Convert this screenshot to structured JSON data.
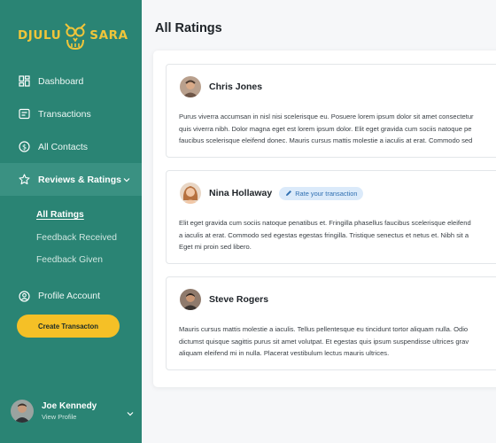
{
  "brand": {
    "left": "DJULU",
    "right": "SARA",
    "accent": "#f0c53a",
    "sidebar_bg": "#2a8474"
  },
  "nav": {
    "dashboard": "Dashboard",
    "transactions": "Transactions",
    "contacts": "All Contacts",
    "reviews": "Reviews & Ratings",
    "sub": [
      "All Ratings",
      "Feedback Received",
      "Feedback Given"
    ],
    "profile": "Profile Account"
  },
  "cta_label": "Create Transacton",
  "user": {
    "name": "Joe Kennedy",
    "sub": "View Profile"
  },
  "main": {
    "title": "All Ratings",
    "reviews": [
      {
        "name": "Chris Jones",
        "lines": [
          "Purus viverra accumsan in nisl nisi scelerisque eu. Posuere lorem ipsum dolor sit amet consectetur",
          "quis viverra nibh. Dolor magna eget est lorem ipsum dolor. Elit eget gravida cum sociis natoque pe",
          "faucibus scelerisque eleifend donec. Mauris cursus mattis molestie a iaculis at erat. Commodo sed"
        ]
      },
      {
        "name": "Nina Hollaway",
        "badge": "Rate your transaction",
        "lines": [
          "Elit eget gravida cum sociis natoque penatibus et. Fringilla phasellus faucibus scelerisque eleifend",
          "a iaculis at erat. Commodo sed egestas egestas fringilla. Tristique senectus et netus et. Nibh sit a",
          "Eget mi proin sed libero."
        ]
      },
      {
        "name": "Steve Rogers",
        "lines": [
          "Mauris cursus mattis molestie a iaculis. Tellus pellentesque eu tincidunt tortor aliquam nulla. Odio",
          "dictumst quisque sagittis purus sit amet volutpat. Et egestas quis ipsum suspendisse ultrices grav",
          "aliquam eleifend mi in nulla. Placerat vestibulum lectus mauris ultrices."
        ]
      }
    ]
  }
}
